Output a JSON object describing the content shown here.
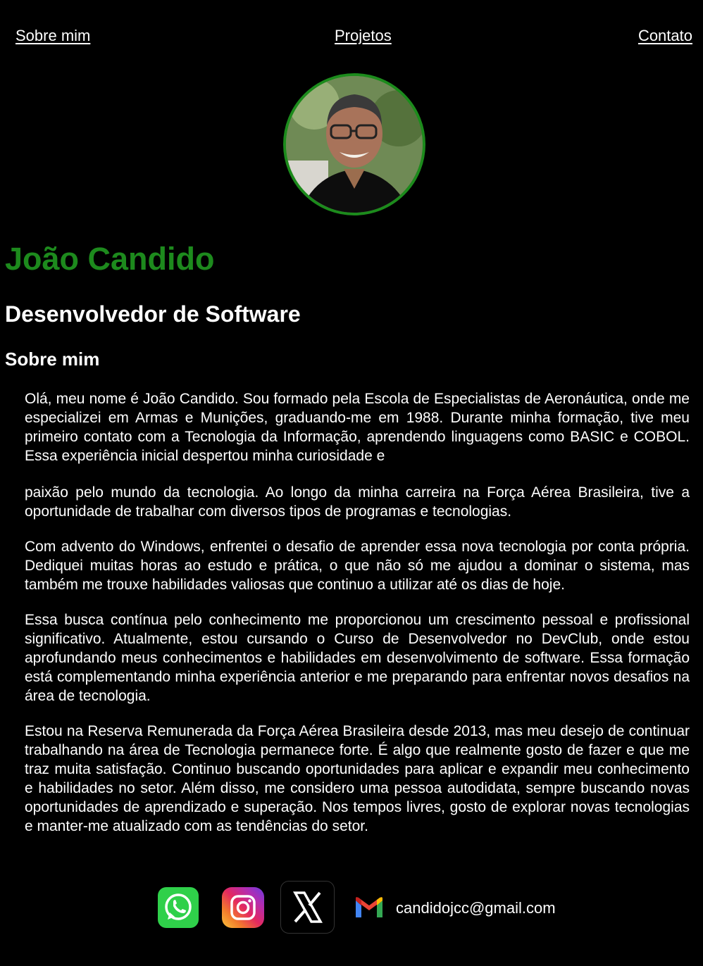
{
  "nav": {
    "about": "Sobre mim",
    "projects": "Projetos",
    "contact": "Contato"
  },
  "profile": {
    "name": "João Candido",
    "role": "Desenvolvedor de Software",
    "about_title": "Sobre mim"
  },
  "bio": [
    "Olá, meu nome é João Candido. Sou formado pela Escola de Especialistas de Aeronáutica, onde me especializei em Armas e Munições, graduando-me em 1988. Durante minha formação, tive meu primeiro contato com a Tecnologia da Informação, aprendendo linguagens como BASIC e COBOL. Essa experiência inicial despertou minha curiosidade e",
    "paixão pelo mundo da tecnologia. Ao longo da minha carreira na Força Aérea Brasileira, tive a oportunidade de trabalhar com diversos tipos de programas e tecnologias.",
    "Com advento do Windows, enfrentei o desafio de aprender essa nova tecnologia por conta própria. Dediquei muitas horas ao estudo e prática, o que não só me ajudou a dominar o sistema, mas também me trouxe habilidades valiosas que continuo a utilizar até os dias de hoje.",
    "Essa busca contínua pelo conhecimento me proporcionou um crescimento pessoal e profissional significativo. Atualmente, estou cursando o Curso de Desenvolvedor no DevClub, onde estou aprofundando meus conhecimentos e habilidades em desenvolvimento de software. Essa formação está complementando minha experiência anterior e me preparando para enfrentar novos desafios na área de tecnologia.",
    "Estou na Reserva Remunerada da Força Aérea Brasileira desde 2013, mas meu desejo de continuar trabalhando na área de Tecnologia permanece forte. É algo que realmente gosto de fazer e que me traz muita satisfação. Continuo buscando oportunidades para aplicar e expandir meu conhecimento e habilidades no setor. Além disso, me considero uma pessoa autodidata, sempre buscando novas oportunidades de aprendizado e superação. Nos tempos livres, gosto de explorar novas tecnologias e manter-me atualizado com as tendências do setor."
  ],
  "contacts": {
    "icons": [
      "whatsapp-icon",
      "instagram-icon",
      "x-icon",
      "gmail-icon"
    ],
    "email": "candidojcc@gmail.com"
  },
  "colors": {
    "background": "#000000",
    "accent": "#1d8a1d",
    "text": "#ffffff"
  }
}
